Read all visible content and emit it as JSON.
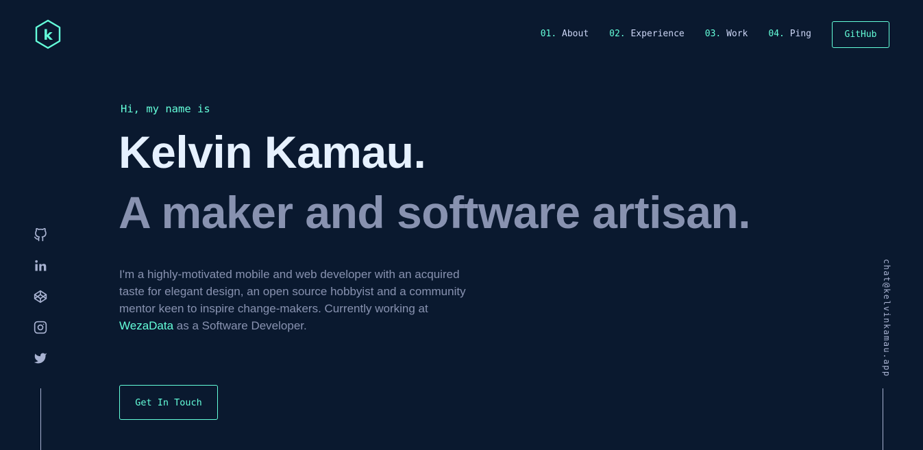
{
  "header": {
    "logo_letter": "k",
    "nav": [
      {
        "num": "01.",
        "label": "About"
      },
      {
        "num": "02.",
        "label": "Experience"
      },
      {
        "num": "03.",
        "label": "Work"
      },
      {
        "num": "04.",
        "label": "Ping"
      }
    ],
    "cta_label": "GitHub"
  },
  "hero": {
    "greeting": "Hi, my name is",
    "name": "Kelvin Kamau.",
    "tagline": "A maker and software artisan.",
    "bio_before": "I'm a highly-motivated mobile and web developer with an acquired taste for elegant design, an open source hobbyist and a community mentor keen to inspire change-makers. Currently working at ",
    "bio_link": "WezaData",
    "bio_after": " as a Software Developer.",
    "button_label": "Get In Touch"
  },
  "social": [
    {
      "icon": "github-icon"
    },
    {
      "icon": "linkedin-icon"
    },
    {
      "icon": "codepen-icon"
    },
    {
      "icon": "instagram-icon"
    },
    {
      "icon": "twitter-icon"
    }
  ],
  "email": "chat@kelvinkamau.app",
  "colors": {
    "background": "#0a192f",
    "accent": "#64ffda",
    "heading": "#e6f1ff",
    "body_text": "#8892b0",
    "nav_text": "#ccd6f6",
    "rail": "#a8b2d1"
  }
}
